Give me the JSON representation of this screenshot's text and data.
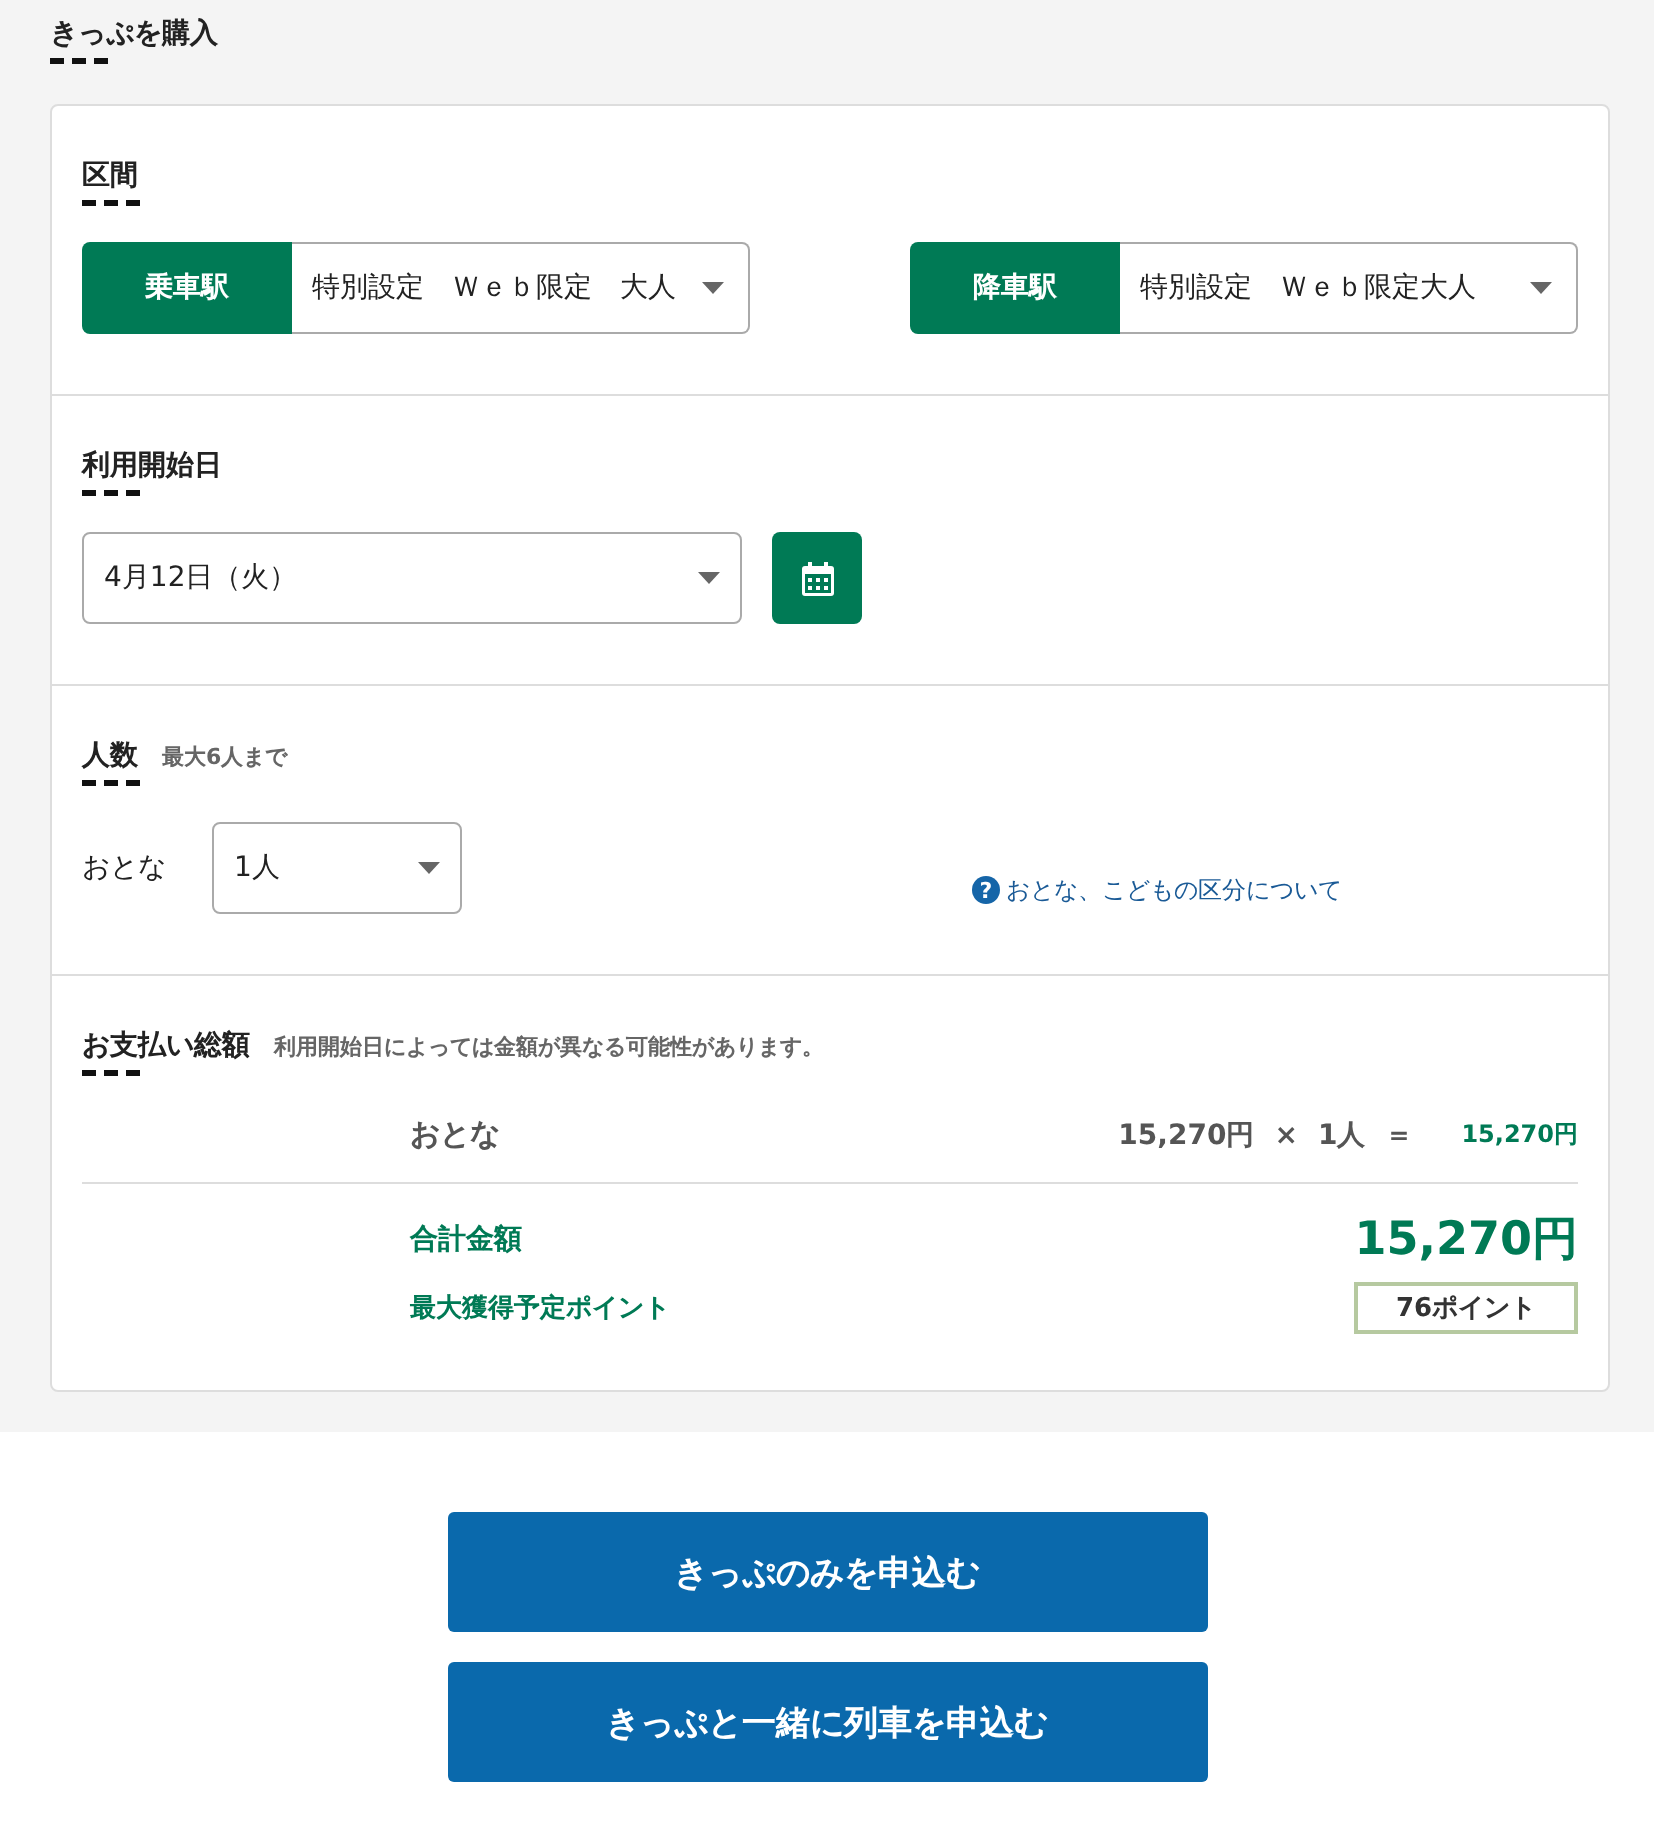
{
  "page_title": "きっぷを購入",
  "route": {
    "heading": "区間",
    "stations": [
      {
        "label": "乗車駅",
        "value": "特別設定　Ｗｅｂ限定　大人"
      },
      {
        "label": "降車駅",
        "value": "特別設定　Ｗｅｂ限定大人"
      }
    ]
  },
  "start_date": {
    "heading": "利用開始日",
    "value": "4月12日（火）"
  },
  "passengers": {
    "heading": "人数",
    "note": "最大6人まで",
    "rows": [
      {
        "label": "おとな",
        "value": "1人"
      }
    ],
    "help_icon": "?",
    "help_link": "おとな、こどもの区分について"
  },
  "payment": {
    "heading": "お支払い総額",
    "note": "利用開始日によっては金額が異なる可能性があります。",
    "lines": [
      {
        "label": "おとな",
        "unit_price": "15,270円",
        "times": "×",
        "count": "1人",
        "equals": "＝",
        "subtotal": "15,270円"
      }
    ],
    "total_label": "合計金額",
    "total": "15,270円",
    "points_label": "最大獲得予定ポイント",
    "points": "76ポイント"
  },
  "buttons": [
    "きっぷのみを申込む",
    "きっぷと一緒に列車を申込む"
  ]
}
